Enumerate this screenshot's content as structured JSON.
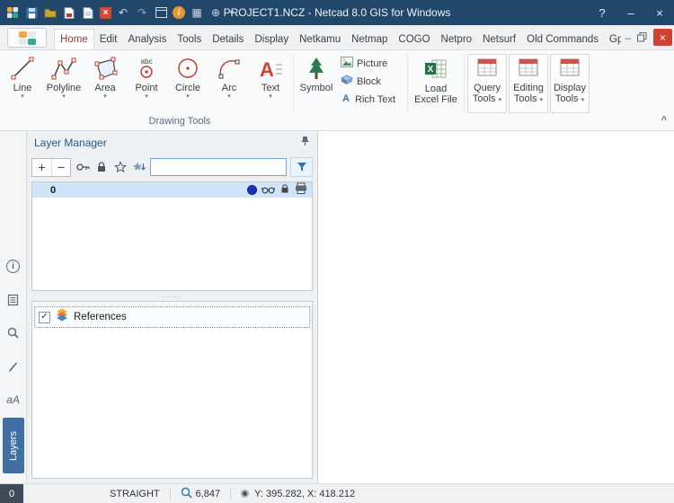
{
  "colors": {
    "titlebar_blue": "#21486b",
    "close_red": "#cf4232",
    "selection_blue": "#cfe4f6",
    "layers_tab_blue": "#3f6fa3",
    "active_tab_red": "#9c3a38",
    "excel_green": "#217346",
    "info_orange": "#e8962e",
    "accent_blue": "#2e75b6",
    "layer_color_dot": "#1d2fbf"
  },
  "titlebar": {
    "title": "PROJECT1.NCZ - Netcad 8.0 GIS for Windows",
    "help": "?",
    "minimize": "–",
    "close": "×"
  },
  "ribbon": {
    "tabs": [
      {
        "label": "Home",
        "active": true
      },
      {
        "label": "Edit"
      },
      {
        "label": "Analysis"
      },
      {
        "label": "Tools"
      },
      {
        "label": "Details"
      },
      {
        "label": "Display"
      },
      {
        "label": "Netkamu"
      },
      {
        "label": "Netmap"
      },
      {
        "label": "COGO"
      },
      {
        "label": "Netpro"
      },
      {
        "label": "Netsurf"
      },
      {
        "label": "Old Commands"
      },
      {
        "label": "Gps"
      }
    ],
    "window_buttons": {
      "minimize": "–",
      "close": "×"
    },
    "drawing": {
      "caption": "Drawing Tools",
      "buttons": [
        {
          "label": "Line"
        },
        {
          "label": "Polyline"
        },
        {
          "label": "Area"
        },
        {
          "label": "Point"
        },
        {
          "label": "Circle"
        },
        {
          "label": "Arc"
        },
        {
          "label": "Text"
        },
        {
          "label": "Symbol"
        }
      ],
      "small_buttons": [
        {
          "label": "Picture"
        },
        {
          "label": "Block"
        },
        {
          "label": "Rich Text"
        }
      ],
      "excel_label": "Load Excel File"
    },
    "tool_buttons": [
      {
        "label": "Query Tools"
      },
      {
        "label": "Editing Tools"
      },
      {
        "label": "Display Tools"
      }
    ]
  },
  "layer_manager": {
    "title": "Layer Manager",
    "toolbar": {
      "add": "+",
      "remove": "−",
      "search_value": ""
    },
    "layers": [
      {
        "name": "0"
      }
    ],
    "splitter_dots": "·····",
    "references": {
      "label": "References"
    }
  },
  "left_strip": {
    "text_tool": "aA",
    "layers_tab": "Layers"
  },
  "status_bar": {
    "layer_badge": "0",
    "mode": "STRAIGHT",
    "zoom": "6,847",
    "coordinates": "Y: 395.282, X: 418.212"
  },
  "icons": {
    "dropdown": "▾",
    "chevron_up": "^",
    "check": "✓",
    "undo": "↶",
    "redo": "↷",
    "grid": "▦",
    "target": "⊕",
    "close_x": "×",
    "info_i": "i",
    "point_abc": "abc",
    "letter_a": "A",
    "excel_x": "X"
  }
}
